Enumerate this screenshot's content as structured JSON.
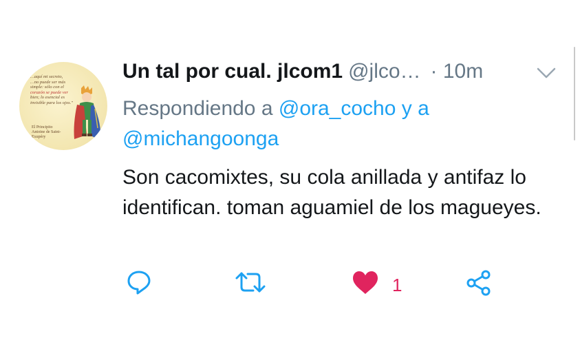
{
  "tweet": {
    "display_name": "Un tal por cual. jlcom1",
    "handle": "@jlco…",
    "time": "· 10m",
    "reply_prefix": "Respondiendo a",
    "reply_joiner": "y a",
    "mentions": [
      "@ora_cocho",
      "@michangoonga"
    ],
    "text": "Son cacomixtes, su cola anillada y antifaz lo identifican. toman aguamiel de los magueyes.",
    "likes": "1",
    "liked": true
  },
  "avatar": {
    "quote_lines": [
      "…aquí mi secreto,",
      "…no puede ser más",
      "simple: sólo con el",
      "corazón se puede ver",
      "bien; lo esencial es",
      "invisible para los ojos.\""
    ],
    "credit_lines": [
      "El Principito",
      "Antoine de Saint-Exupéry"
    ]
  },
  "colors": {
    "text": "#14171a",
    "secondary": "#657786",
    "link": "#1da1f2",
    "like": "#e0245e"
  },
  "icons": [
    "chevron-down-icon",
    "reply-icon",
    "retweet-icon",
    "heart-icon",
    "share-icon"
  ]
}
